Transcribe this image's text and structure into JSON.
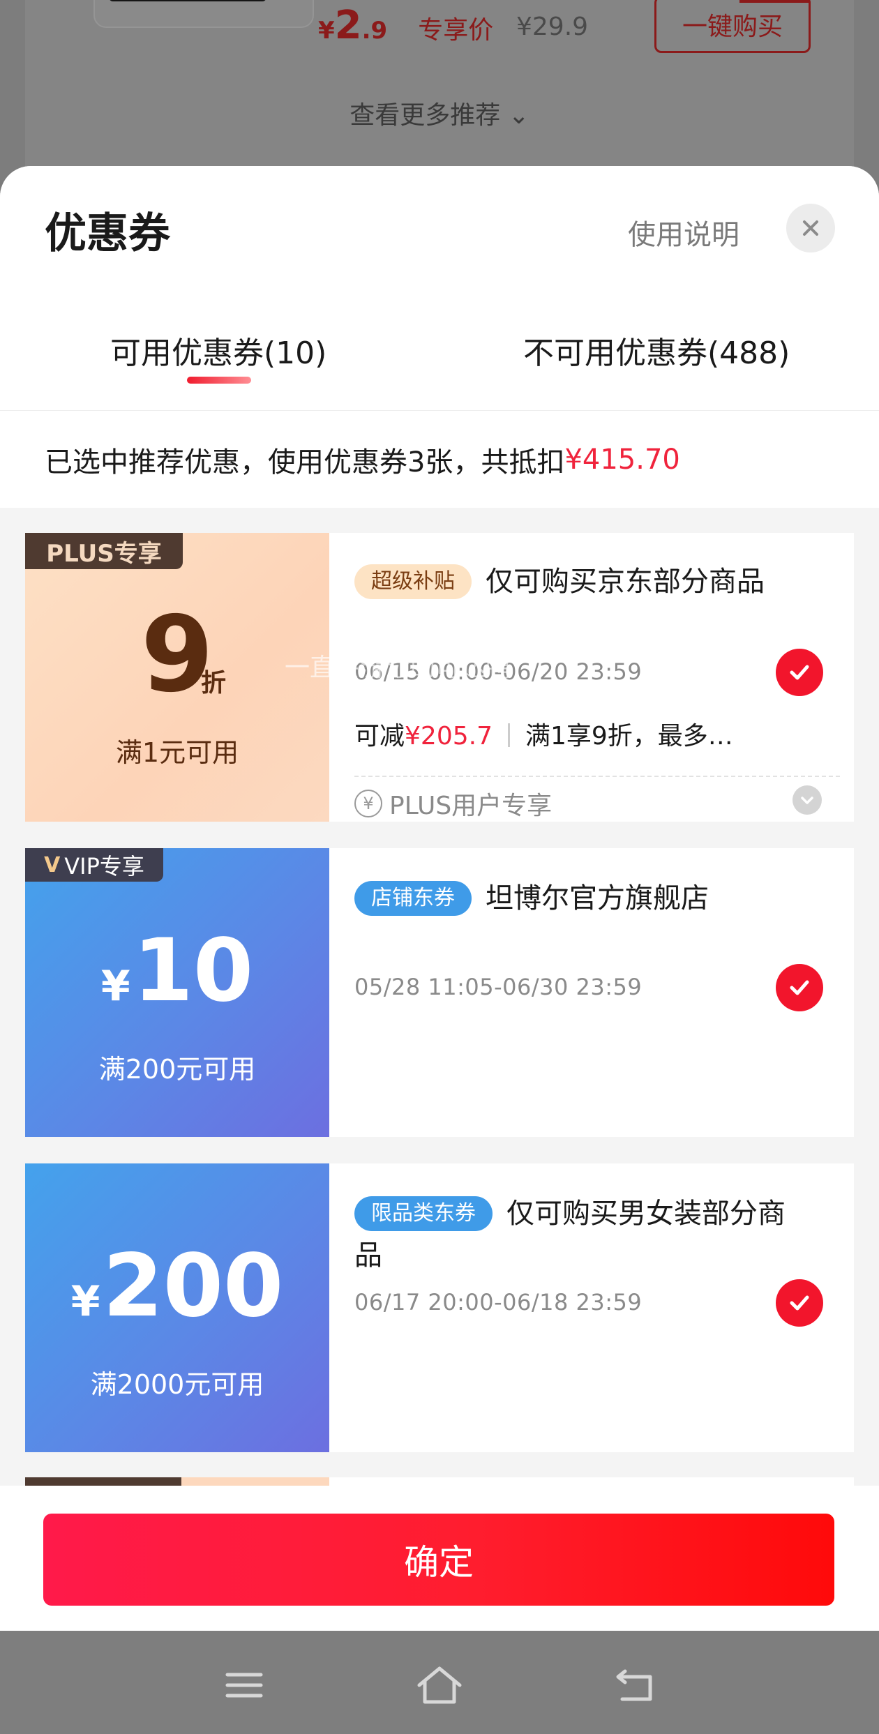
{
  "background": {
    "price_yen": "¥",
    "price_int": "2",
    "price_dec": ".9",
    "price_tag": "专享价",
    "original_price": "¥29.9",
    "buy_button": "一键购买",
    "see_more": "查看更多推荐 ⌄"
  },
  "sheet": {
    "title": "优惠券",
    "help_link": "使用说明",
    "close_icon": "close-icon",
    "tabs": [
      {
        "label": "可用优惠券(10)",
        "active": true
      },
      {
        "label": "不可用优惠券(488)",
        "active": false
      }
    ],
    "summary_prefix": "已选中推荐优惠，使用优惠券3张，共抵扣",
    "summary_amount": "¥415.70"
  },
  "coupons": [
    {
      "badge": "PLUS专享",
      "value": "9",
      "unit": "折",
      "condition": "满1元可用",
      "tag": "超级补贴",
      "title": "仅可购买京东部分商品",
      "validity": "06/15 00:00-06/20 23:59",
      "deduct_label": "可减",
      "deduct_amount": "¥205.7",
      "deduct_desc": "满1享9折，最多…",
      "footer_note": "PLUS用户专享",
      "checked": true
    },
    {
      "badge": "VIP专享",
      "badge_glyph": "V",
      "yen": "¥",
      "value": "10",
      "condition": "满200元可用",
      "tag": "店铺东券",
      "title": "坦博尔官方旗舰店",
      "validity": "05/28 11:05-06/30 23:59",
      "checked": true
    },
    {
      "yen": "¥",
      "value": "200",
      "condition": "满2000元可用",
      "tag": "限品类东券",
      "title": "仅可购买男女装部分商品",
      "validity": "06/17 20:00-06/18 23:59",
      "checked": true
    }
  ],
  "watermark": "一直会游泳的可达鸭",
  "confirm_button": "确定",
  "colors": {
    "accent_red": "#f2152c",
    "plus_gold": "#fdd4b8",
    "coupon_blue": "#5b88e6"
  },
  "nav": {
    "icons": [
      "menu-icon",
      "home-icon",
      "back-icon"
    ]
  }
}
